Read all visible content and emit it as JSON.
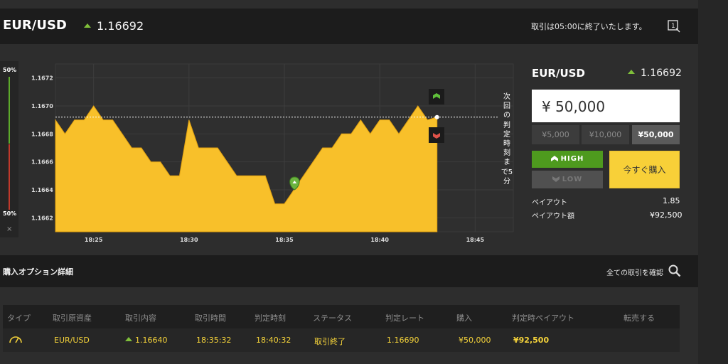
{
  "header": {
    "pair": "EUR/USD",
    "rate": "1.16692",
    "close_notice": "取引は05:00に終了いたします。",
    "window_icon_label": "1"
  },
  "gauge": {
    "top_label": "50%",
    "bottom_label": "50%",
    "close_glyph": "×"
  },
  "chart_data": {
    "type": "area",
    "x_ticks": [
      "18:25",
      "18:30",
      "18:35",
      "18:40",
      "18:45"
    ],
    "y_ticks": [
      "1.1672",
      "1.1670",
      "1.1668",
      "1.1666",
      "1.1664",
      "1.1662"
    ],
    "ylim": [
      1.1661,
      1.1673
    ],
    "xlim": [
      "18:23",
      "18:47"
    ],
    "current_rate": 1.16692,
    "purchase_rate": 1.1664,
    "purchase_time": "18:35:32",
    "series": [
      {
        "color": "#f8c02a",
        "x": [
          "18:23:00",
          "18:23:30",
          "18:24:00",
          "18:24:30",
          "18:25:00",
          "18:25:30",
          "18:26:00",
          "18:26:30",
          "18:27:00",
          "18:27:30",
          "18:28:00",
          "18:28:30",
          "18:29:00",
          "18:29:30",
          "18:30:00",
          "18:30:30",
          "18:31:00",
          "18:31:30",
          "18:32:00",
          "18:32:30",
          "18:33:00",
          "18:33:30",
          "18:34:00",
          "18:34:30",
          "18:35:00",
          "18:35:30",
          "18:36:00",
          "18:36:30",
          "18:37:00",
          "18:37:30",
          "18:38:00",
          "18:38:30",
          "18:39:00",
          "18:39:30",
          "18:40:00",
          "18:40:30",
          "18:41:00",
          "18:41:30",
          "18:42:00",
          "18:42:30",
          "18:43:00"
        ],
        "y": [
          1.1669,
          1.1668,
          1.1669,
          1.1669,
          1.167,
          1.1669,
          1.1669,
          1.1668,
          1.1667,
          1.1667,
          1.1666,
          1.1666,
          1.1665,
          1.1665,
          1.1669,
          1.1667,
          1.1667,
          1.1667,
          1.1666,
          1.1665,
          1.1665,
          1.1665,
          1.1665,
          1.1663,
          1.1663,
          1.1664,
          1.1665,
          1.1666,
          1.1667,
          1.1667,
          1.1668,
          1.1668,
          1.1669,
          1.1668,
          1.1669,
          1.1669,
          1.1668,
          1.1669,
          1.167,
          1.1669,
          1.16692
        ]
      }
    ]
  },
  "next_judge_text": "次回の判定時刻まで5分",
  "order": {
    "pair": "EUR/USD",
    "rate": "1.16692",
    "amount": "¥ 50,000",
    "amount_buttons": [
      "¥5,000",
      "¥10,000",
      "¥50,000"
    ],
    "high_label": "HIGH",
    "low_label": "LOW",
    "buy_label": "今すぐ購入",
    "payout_label": "ペイアウト",
    "payout_value": "1.85",
    "payout_amount_label": "ペイアウト額",
    "payout_amount_value": "¥92,500"
  },
  "options": {
    "title": "購入オプション詳細",
    "confirm_label": "全ての取引を確認"
  },
  "table": {
    "headers": [
      "タイプ",
      "取引原資産",
      "取引内容",
      "取引時間",
      "判定時刻",
      "ステータス",
      "判定レート",
      "購入",
      "判定時ペイアウト",
      "転売する"
    ],
    "row": {
      "asset": "EUR/USD",
      "content": "1.16640",
      "trade_time": "18:35:32",
      "judge_time": "18:40:32",
      "status": "取引終了",
      "judge_rate": "1.16690",
      "purchase": "¥50,000",
      "payout": "¥92,500"
    }
  },
  "colors": {
    "accent_yellow": "#f8c02a",
    "high_green": "#4e9a1e",
    "up_green": "#7fbf3a",
    "down_red": "#d9534f"
  }
}
